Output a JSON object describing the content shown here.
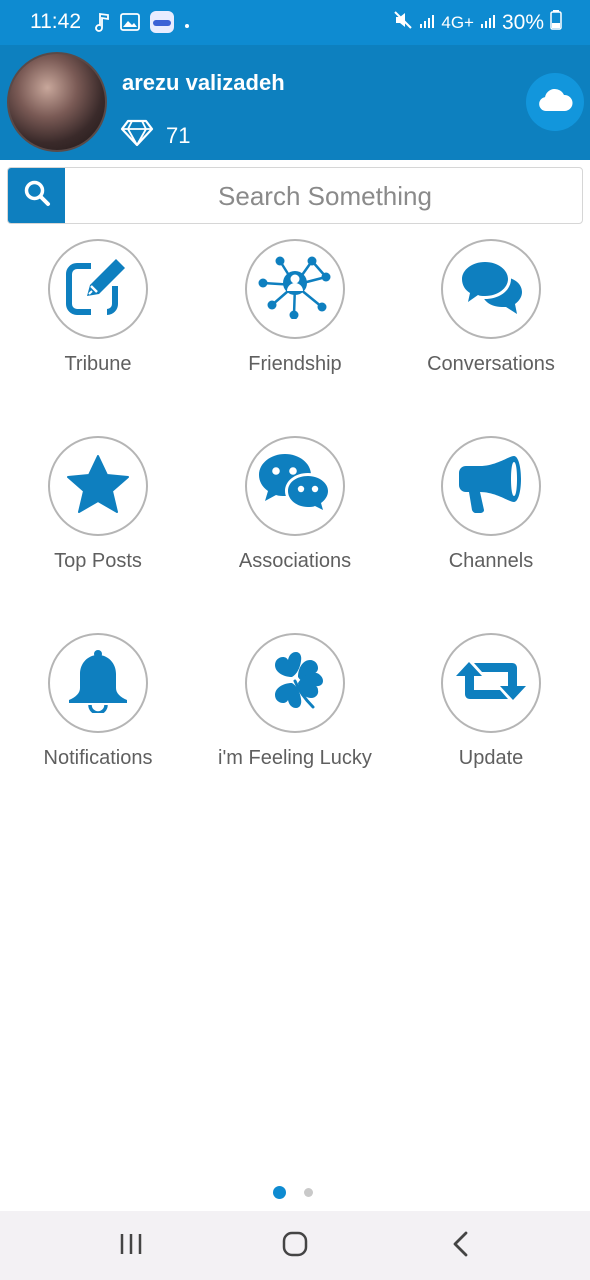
{
  "status_bar": {
    "time": "11:42",
    "battery": "30%",
    "network": "4G+"
  },
  "profile": {
    "name": "arezu valizadeh",
    "points": "71"
  },
  "search": {
    "placeholder": "Search Something"
  },
  "menu": [
    {
      "label": "Tribune",
      "icon": "edit-icon"
    },
    {
      "label": "Friendship",
      "icon": "network-icon"
    },
    {
      "label": "Conversations",
      "icon": "chat-bubbles-icon"
    },
    {
      "label": "Top Posts",
      "icon": "star-icon"
    },
    {
      "label": "Associations",
      "icon": "wechat-icon"
    },
    {
      "label": "Channels",
      "icon": "megaphone-icon"
    },
    {
      "label": "Notifications",
      "icon": "bell-icon"
    },
    {
      "label": "i'm Feeling Lucky",
      "icon": "clover-icon"
    },
    {
      "label": "Update",
      "icon": "retweet-icon"
    }
  ],
  "pager": {
    "pages": 2,
    "active": 1
  },
  "colors": {
    "accent": "#0e7fbf",
    "header": "#0d80bf",
    "status_bar": "#0e8bd1",
    "label": "#5f5f5f"
  }
}
